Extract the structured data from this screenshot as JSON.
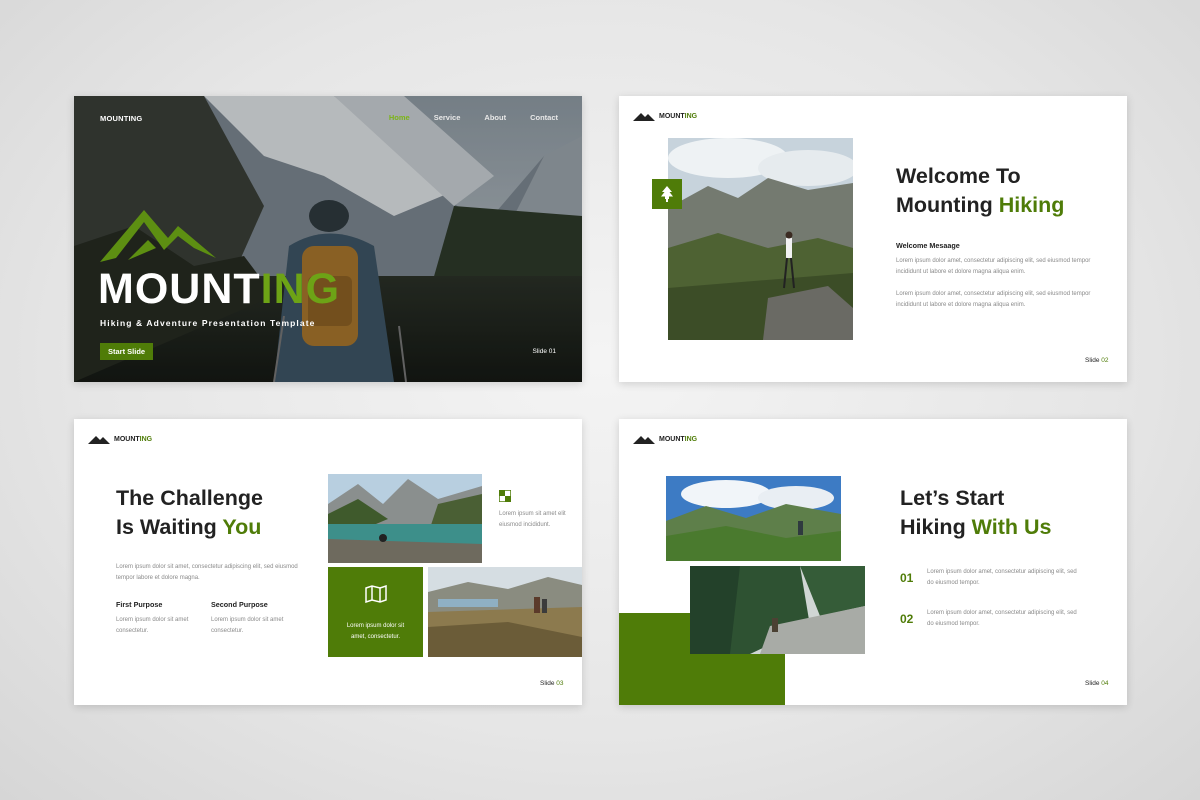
{
  "slide1": {
    "brand": "MOUNTING",
    "nav": [
      "Home",
      "Service",
      "About",
      "Contact"
    ],
    "title_white": "MOUNT",
    "title_green": "ING",
    "subtitle": "Hiking & Adventure Presentation Template",
    "button": "Start Slide",
    "slide_label": "Slide 01"
  },
  "header": {
    "brand_dark": "MOUNT",
    "brand_green": "ING"
  },
  "slide2": {
    "title_line1": "Welcome To",
    "title_line2_dark": "Mounting ",
    "title_line2_green": "Hiking",
    "label": "Welcome Mesaage",
    "para1": "Lorem ipsum dolor amet, consectetur adipiscing elit, sed eiusmod tempor incididunt ut labore et dolore magna aliqua enim.",
    "para2": "Lorem ipsum dolor amet, consectetur adipiscing elit, sed eiusmod tempor incididunt ut labore et dolore magna aliqua enim.",
    "slide_word": "Slide ",
    "slide_num": "02"
  },
  "slide3": {
    "title_line1": "The Challenge",
    "title_line2_dark": "Is Waiting ",
    "title_line2_green": "You",
    "para": "Lorem ipsum dolor sit amet, consectetur adipiscing elit, sed eiusmod tempor labore et dolore magna.",
    "purpose1_label": "First Purpose",
    "purpose1_text": "Lorem ipsum dolor sit amet consectetur.",
    "purpose2_label": "Second Purpose",
    "purpose2_text": "Lorem ipsum dolor sit amet consectetur.",
    "side_text": "Lorem ipsum sit amet elit eiusmod incididunt.",
    "greenbox_text": "Lorem ipsum dolor sit amet, consectetur.",
    "slide_word": "Slide ",
    "slide_num": "03"
  },
  "slide4": {
    "title_line1": "Let’s Start",
    "title_line2_dark": "Hiking ",
    "title_line2_green": "With Us",
    "item1_num": "01",
    "item1_text": "Lorem ipsum dolor amet, consectetur adipiscing elit, sed do eiusmod tempor.",
    "item2_num": "02",
    "item2_text": "Lorem ipsum dolor amet, consectetur adipiscing elit, sed do eiusmod tempor.",
    "slide_word": "Slide ",
    "slide_num": "04"
  },
  "icons": [
    "mountain-logo-icon",
    "tree-icon",
    "map-icon",
    "checker-icon"
  ],
  "colors": {
    "accent": "#4f7c08",
    "accent_light": "#6da316",
    "text_dark": "#222222",
    "text_muted": "#8a8a8a"
  }
}
